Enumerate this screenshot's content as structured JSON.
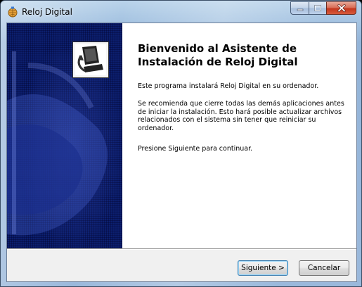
{
  "window": {
    "title": "Reloj Digital",
    "app_icon": "installer-globe-icon",
    "caption_buttons": [
      "minimize-icon",
      "maximize-icon",
      "close-icon"
    ]
  },
  "side_panel": {
    "icon": "computer-install-icon"
  },
  "content": {
    "heading": "Bienvenido al Asistente de Instalación de Reloj Digital",
    "paragraph_1": "Este programa instalará Reloj Digital en su ordenador.",
    "paragraph_2": "Se recomienda que cierre todas las demás aplicaciones antes de iniciar la instalación. Esto hará posible actualizar archivos relacionados con el sistema sin tener que reiniciar su ordenador.",
    "paragraph_3": "Presione Siguiente para continuar."
  },
  "buttons": {
    "next_label": "Siguiente >",
    "cancel_label": "Cancelar"
  },
  "colors": {
    "side_panel": "#0c1f6e",
    "close_button": "#c4371e",
    "default_button_border": "#3c7fb1"
  }
}
